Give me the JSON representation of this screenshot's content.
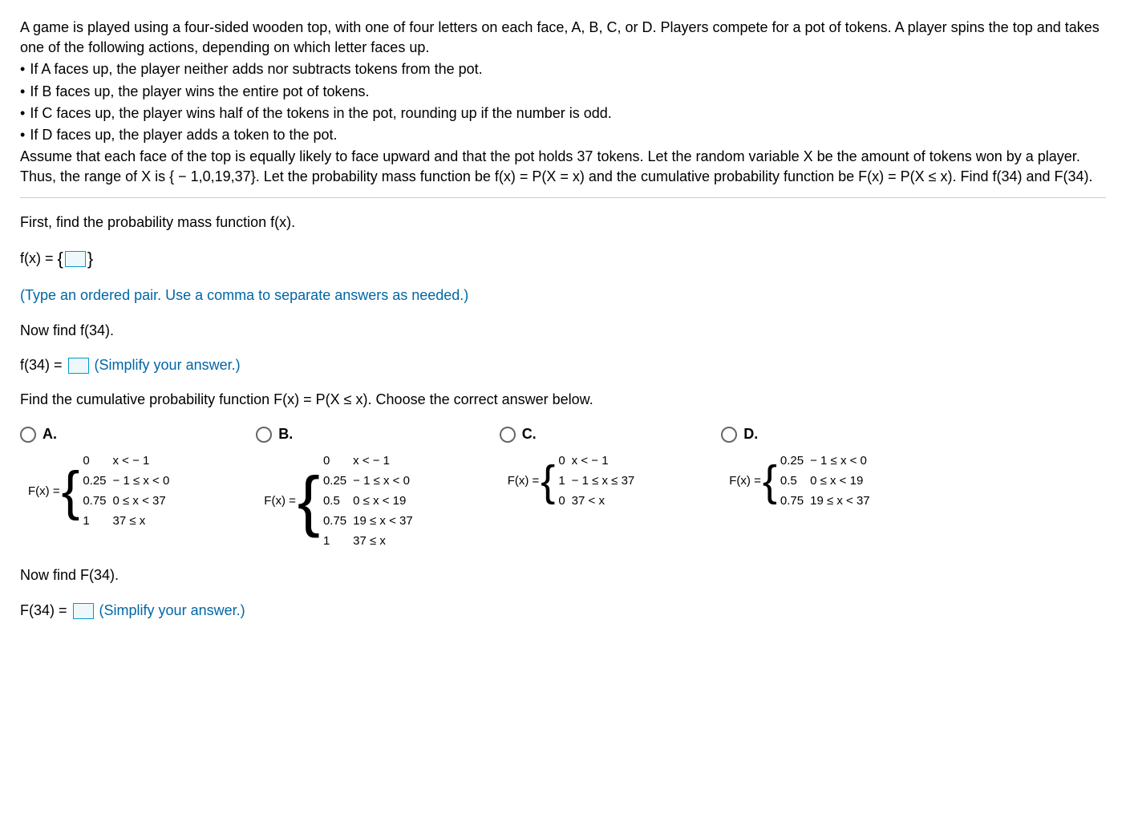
{
  "intro": {
    "p1": "A game is played using a four-sided wooden top, with one of four letters on each face, A, B, C, or D. Players compete for a pot of tokens. A player spins the top and takes one of the following actions, depending on which letter faces up.",
    "b1": "If A faces up, the player neither adds nor subtracts tokens from the pot.",
    "b2": "If B faces up, the player wins the entire pot of tokens.",
    "b3": "If C faces up, the player wins half of the tokens in the pot, rounding up if the number is odd.",
    "b4": "If D faces up, the player adds a token to the pot.",
    "p2": "Assume that each face of the top is equally likely to face upward and that the pot holds 37 tokens. Let the random variable X be the amount of tokens won by a player. Thus, the range of X is { − 1,0,19,37}. Let the probability mass function be f(x) = P(X = x) and the cumulative probability function be F(x) = P(X ≤ x). Find f(34) and F(34)."
  },
  "q1": {
    "prompt": "First, find the probability mass function f(x).",
    "equation": "f(x) = ",
    "hint": "(Type an ordered pair. Use a comma to separate answers as needed.)"
  },
  "q2": {
    "prompt": "Now find f(34).",
    "equation": "f(34) = ",
    "hint": "(Simplify your answer.)"
  },
  "q3": {
    "prompt": "Find the cumulative probability function F(x) = P(X ≤ x). Choose the correct answer below."
  },
  "choices": {
    "A": {
      "label": "A.",
      "prefix": "F(x) = ",
      "rows": [
        {
          "v": "0",
          "c": "x < − 1"
        },
        {
          "v": "0.25",
          "c": "− 1 ≤ x < 0"
        },
        {
          "v": "0.75",
          "c": "0 ≤ x < 37"
        },
        {
          "v": "1",
          "c": "37 ≤ x"
        }
      ]
    },
    "B": {
      "label": "B.",
      "prefix": "F(x) = ",
      "rows": [
        {
          "v": "0",
          "c": "x < − 1"
        },
        {
          "v": "0.25",
          "c": "− 1 ≤ x < 0"
        },
        {
          "v": "0.5",
          "c": "0 ≤ x < 19"
        },
        {
          "v": "0.75",
          "c": "19 ≤ x < 37"
        },
        {
          "v": "1",
          "c": "37 ≤ x"
        }
      ]
    },
    "C": {
      "label": "C.",
      "prefix": "F(x) = ",
      "rows": [
        {
          "v": "0",
          "c": "x < − 1"
        },
        {
          "v": "1",
          "c": "− 1 ≤ x ≤ 37"
        },
        {
          "v": "0",
          "c": "37 < x"
        }
      ]
    },
    "D": {
      "label": "D.",
      "prefix": "F(x) = ",
      "rows": [
        {
          "v": "0.25",
          "c": "− 1 ≤ x < 0"
        },
        {
          "v": "0.5",
          "c": "0 ≤ x < 19"
        },
        {
          "v": "0.75",
          "c": "19 ≤ x < 37"
        }
      ]
    }
  },
  "q4": {
    "prompt": "Now find F(34).",
    "equation": "F(34) = ",
    "hint": "(Simplify your answer.)"
  }
}
